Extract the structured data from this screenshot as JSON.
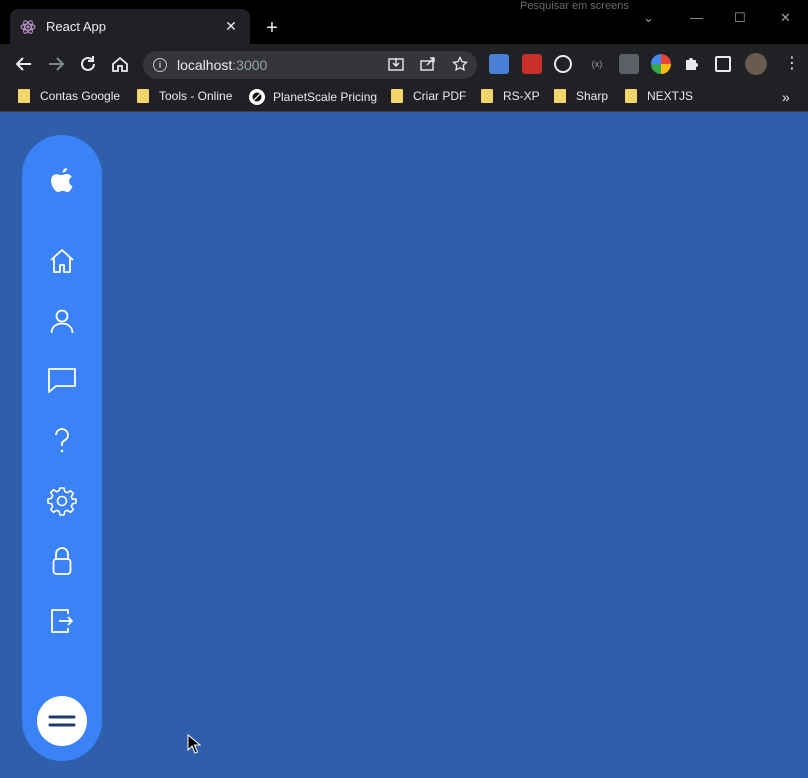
{
  "browser": {
    "tab": {
      "title": "React App",
      "close_glyph": "✕",
      "favicon": "react-favicon"
    },
    "new_tab_glyph": "+",
    "window_controls": {
      "minimize": "—",
      "maximize": "☐",
      "close": "✕",
      "dropdown": "⌄"
    },
    "background_tab_hint": "Pesquisar em screens",
    "address": {
      "host": "localhost",
      "port": ":3000"
    },
    "bookmarks": [
      {
        "label": "Contas Google",
        "icon": "folder-icon"
      },
      {
        "label": "Tools - Online",
        "icon": "folder-icon"
      },
      {
        "label": "PlanetScale Pricing",
        "icon": "planetscale-icon"
      },
      {
        "label": "Criar PDF",
        "icon": "folder-icon"
      },
      {
        "label": "RS-XP",
        "icon": "folder-icon"
      },
      {
        "label": "Sharp",
        "icon": "folder-icon"
      },
      {
        "label": "NEXTJS",
        "icon": "folder-icon"
      }
    ],
    "bookmarks_overflow": "»"
  },
  "sidebar": {
    "logo": "apple-icon",
    "items": [
      {
        "name": "home",
        "icon": "home-icon"
      },
      {
        "name": "profile",
        "icon": "user-icon"
      },
      {
        "name": "messages",
        "icon": "chat-icon"
      },
      {
        "name": "help",
        "icon": "question-icon"
      },
      {
        "name": "settings",
        "icon": "gear-icon"
      },
      {
        "name": "security",
        "icon": "lock-icon"
      },
      {
        "name": "logout",
        "icon": "logout-icon"
      }
    ],
    "menu_button": "menu-icon"
  },
  "colors": {
    "page_background": "#2f5eaa",
    "sidebar": "#3b82f6",
    "chrome_dark": "#202124"
  }
}
